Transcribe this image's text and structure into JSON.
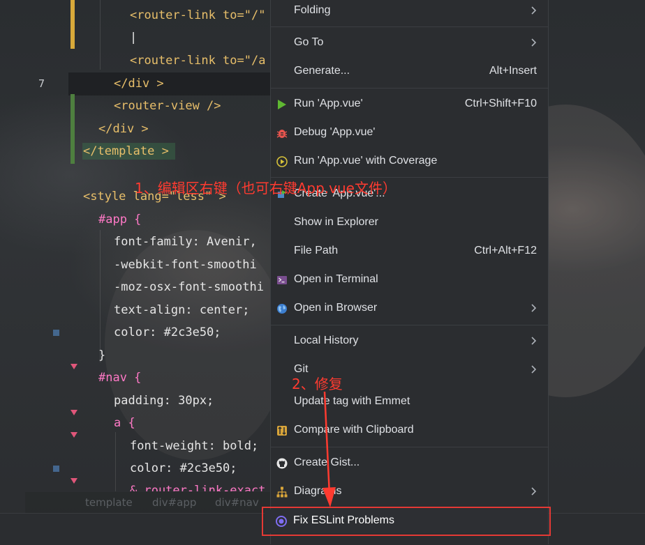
{
  "editor": {
    "line_numbers": [
      {
        "n": "7",
        "current": true
      }
    ],
    "code_lines": [
      {
        "text": "<router-link to=\"/\""
      },
      {
        "text": "|"
      },
      {
        "text": "<router-link to=\"/a"
      },
      {
        "text": "</div >"
      },
      {
        "text": "<router-view />"
      },
      {
        "text": "</div >"
      },
      {
        "text": "</template >"
      },
      {
        "text": "<style lang=\"less\" >"
      },
      {
        "text": "#app {"
      },
      {
        "text": "font-family: Avenir,"
      },
      {
        "text": "-webkit-font-smoothi"
      },
      {
        "text": "-moz-osx-font-smoothi"
      },
      {
        "text": "text-align: center;"
      },
      {
        "text": "color: #2c3e50;"
      },
      {
        "text": "}"
      },
      {
        "text": "#nav {"
      },
      {
        "text": "padding: 30px;"
      },
      {
        "text": "a {"
      },
      {
        "text": "font-weight: bold;"
      },
      {
        "text": "color: #2c3e50;"
      },
      {
        "text": "&.router-link-exact"
      }
    ],
    "breadcrumb": [
      "template",
      "div#app",
      "div#nav"
    ]
  },
  "context_menu": {
    "items": [
      {
        "label": "Folding",
        "shortcut": "",
        "submenu": true,
        "icon": ""
      },
      {
        "label": "Go To",
        "shortcut": "",
        "submenu": true,
        "icon": ""
      },
      {
        "label": "Generate...",
        "shortcut": "Alt+Insert",
        "submenu": false,
        "icon": ""
      },
      {
        "label": "Run 'App.vue'",
        "shortcut": "Ctrl+Shift+F10",
        "submenu": false,
        "icon": "run-icon"
      },
      {
        "label": "Debug 'App.vue'",
        "shortcut": "",
        "submenu": false,
        "icon": "debug-icon"
      },
      {
        "label": "Run 'App.vue' with Coverage",
        "shortcut": "",
        "submenu": false,
        "icon": "coverage-icon"
      },
      {
        "label": "Create 'App.vue'...",
        "shortcut": "",
        "submenu": false,
        "icon": "create-config-icon"
      },
      {
        "label": "Show in Explorer",
        "shortcut": "",
        "submenu": false,
        "icon": ""
      },
      {
        "label": "File Path",
        "shortcut": "Ctrl+Alt+F12",
        "submenu": false,
        "icon": ""
      },
      {
        "label": "Open in Terminal",
        "shortcut": "",
        "submenu": false,
        "icon": "terminal-icon"
      },
      {
        "label": "Open in Browser",
        "shortcut": "",
        "submenu": true,
        "icon": "globe-icon"
      },
      {
        "label": "Local History",
        "shortcut": "",
        "submenu": true,
        "icon": ""
      },
      {
        "label": "Git",
        "shortcut": "",
        "submenu": true,
        "icon": ""
      },
      {
        "label": "Update tag with Emmet",
        "shortcut": "",
        "submenu": false,
        "icon": ""
      },
      {
        "label": "Compare with Clipboard",
        "shortcut": "",
        "submenu": false,
        "icon": "compare-icon"
      },
      {
        "label": "Create Gist...",
        "shortcut": "",
        "submenu": false,
        "icon": "github-icon"
      },
      {
        "label": "Diagrams",
        "shortcut": "",
        "submenu": true,
        "icon": "diagram-icon"
      },
      {
        "label": "Fix ESLint Problems",
        "shortcut": "",
        "submenu": false,
        "icon": "eslint-icon"
      }
    ]
  },
  "annotations": {
    "step1": "1、编辑区右键（也可右键App.vue文件）",
    "step2": "2、修复"
  },
  "colors": {
    "menu_bg": "#2b2d30",
    "annotation_red": "#ff3b30",
    "tag_yellow": "#e8bf6a",
    "run_green": "#5fb832",
    "debug_red": "#e8554e",
    "eslint_purple": "#7f6df2"
  }
}
